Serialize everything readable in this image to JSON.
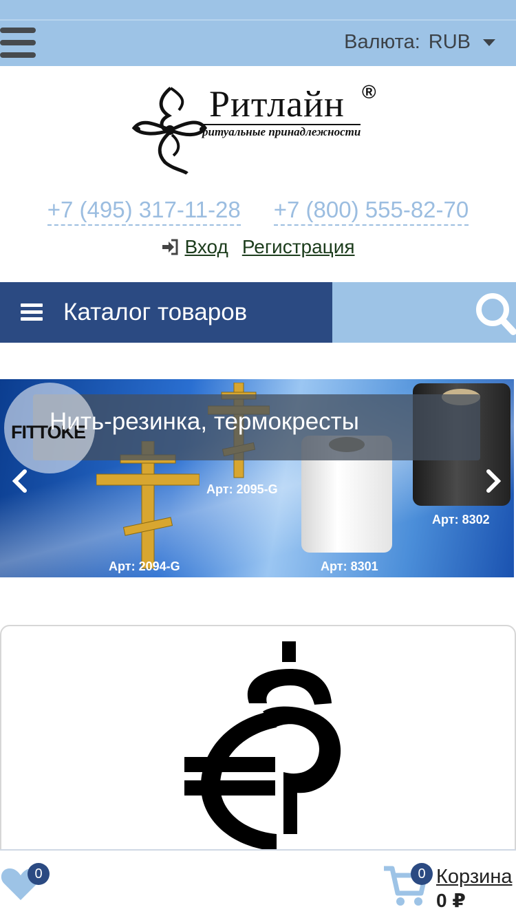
{
  "header": {
    "currency_label": "Валюта:",
    "currency_value": "RUB"
  },
  "logo": {
    "name": "Ритлайн",
    "registered": "®",
    "tagline": "ритуальные принадлежности"
  },
  "contacts": {
    "phone1": "+7 (495) 317-11-28",
    "phone2": "+7 (800) 555-82-70"
  },
  "auth": {
    "login": "Вход",
    "register": "Регистрация"
  },
  "catalog": {
    "label": "Каталог товаров"
  },
  "banner": {
    "title": "Нить-резинка, термокресты",
    "brand": "FITTOKE",
    "articles": [
      "Арт: 2095-G",
      "Арт: 2094-G",
      "Арт: 8301",
      "Арт: 8302"
    ]
  },
  "bottom": {
    "favorites_count": "0",
    "cart_count": "0",
    "cart_label": "Корзина",
    "cart_total": "0 ₽"
  },
  "colors": {
    "topbar": "#9dc3e6",
    "catalog": "#2b4a82",
    "phone": "#9bbde0",
    "badge": "#2b4a82"
  }
}
